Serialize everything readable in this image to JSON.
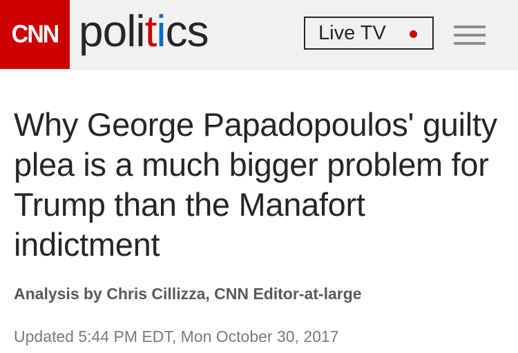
{
  "header": {
    "logo_text": "CNN",
    "section_title": {
      "part1": "poli",
      "part2": "t",
      "part3": "i",
      "part4": "cs"
    },
    "live_tv_label": "Live TV",
    "menu_icon": "hamburger-menu-icon"
  },
  "article": {
    "headline": "Why George Papadopoulos' guilty plea is a much bigger problem for Trump than the Manafort indictment",
    "byline": "Analysis by Chris Cillizza, CNN Editor-at-large",
    "timestamp": "Updated 5:44 PM EDT, Mon October 30, 2017"
  },
  "colors": {
    "brand_red": "#cc0000",
    "brand_blue": "#0c6bbf",
    "header_bg": "#f1f1f1",
    "text_dark": "#262626"
  }
}
